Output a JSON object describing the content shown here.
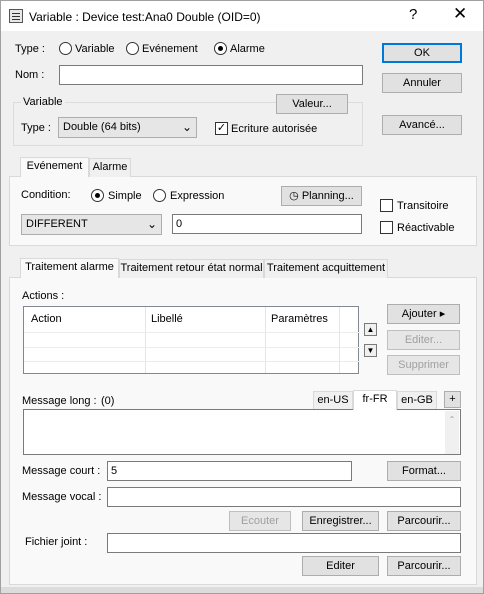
{
  "window": {
    "title": "Variable : Device test:Ana0 Double (OID=0)",
    "help": "?",
    "close": "✕"
  },
  "type_row": {
    "label": "Type :",
    "options": [
      "Variable",
      "Evénement",
      "Alarme"
    ],
    "selected": "Alarme"
  },
  "nom": {
    "label": "Nom :",
    "value": ""
  },
  "buttons": {
    "ok": "OK",
    "annuler": "Annuler",
    "avance": "Avancé...",
    "valeur": "Valeur..."
  },
  "variable_group": {
    "title": "Variable",
    "type_label": "Type :",
    "type_value": "Double (64 bits)",
    "write_allowed_label": "Ecriture autorisée",
    "write_allowed_checked": true
  },
  "event_tabs": [
    "Evénement",
    "Alarme"
  ],
  "condition": {
    "label": "Condition:",
    "options": [
      "Simple",
      "Expression"
    ],
    "selected": "Simple",
    "planning": "Planning...",
    "operator": "DIFFERENT",
    "value": "0",
    "transitoire": "Transitoire",
    "reactivable": "Réactivable"
  },
  "treatment_tabs": [
    "Traitement alarme",
    "Traitement retour état normal",
    "Traitement acquittement"
  ],
  "actions": {
    "label": "Actions :",
    "columns": [
      "Action",
      "Libellé",
      "Paramètres"
    ],
    "ajouter": "Ajouter",
    "editer": "Editer...",
    "supprimer": "Supprimer"
  },
  "message_long": {
    "label": "Message long :",
    "count": "(0)",
    "langs": [
      "en-US",
      "fr-FR",
      "en-GB"
    ],
    "active_lang": "fr-FR",
    "add": "+"
  },
  "message_court": {
    "label": "Message court :",
    "value": "5",
    "format": "Format..."
  },
  "message_vocal": {
    "label": "Message vocal :",
    "value": "",
    "ecouter": "Ecouter",
    "enregistrer": "Enregistrer...",
    "parcourir": "Parcourir..."
  },
  "fichier_joint": {
    "label": "Fichier joint :",
    "value": "",
    "editer": "Editer",
    "parcourir": "Parcourir..."
  }
}
